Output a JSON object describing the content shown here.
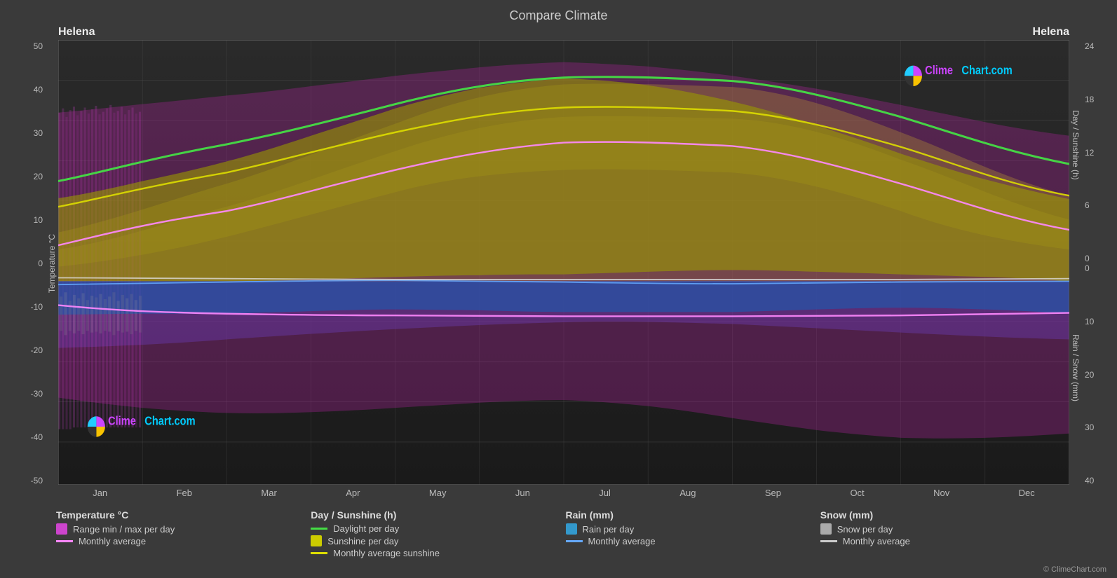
{
  "title": "Compare Climate",
  "location_left": "Helena",
  "location_right": "Helena",
  "y_axis_left_label": "Temperature °C",
  "y_axis_right_top_label": "Day / Sunshine (h)",
  "y_axis_right_bottom_label": "Rain / Snow (mm)",
  "y_ticks_left": [
    "50",
    "40",
    "30",
    "20",
    "10",
    "0",
    "-10",
    "-20",
    "-30",
    "-40",
    "-50"
  ],
  "y_ticks_right_top": [
    "24",
    "18",
    "12",
    "6",
    "0"
  ],
  "y_ticks_right_bottom": [
    "0",
    "10",
    "20",
    "30",
    "40"
  ],
  "x_ticks": [
    "Jan",
    "Feb",
    "Mar",
    "Apr",
    "May",
    "Jun",
    "Jul",
    "Aug",
    "Sep",
    "Oct",
    "Nov",
    "Dec"
  ],
  "logo_text": "ClimeChart.com",
  "copyright": "© ClimeChart.com",
  "legend": {
    "col1_title": "Temperature °C",
    "col1_items": [
      {
        "type": "rect",
        "color": "#cc44cc",
        "label": "Range min / max per day"
      },
      {
        "type": "line",
        "color": "#ff88ff",
        "label": "Monthly average"
      }
    ],
    "col2_title": "Day / Sunshine (h)",
    "col2_items": [
      {
        "type": "line",
        "color": "#44dd44",
        "label": "Daylight per day"
      },
      {
        "type": "rect",
        "color": "#cccc00",
        "label": "Sunshine per day"
      },
      {
        "type": "line",
        "color": "#dddd00",
        "label": "Monthly average sunshine"
      }
    ],
    "col3_title": "Rain (mm)",
    "col3_items": [
      {
        "type": "rect",
        "color": "#3399cc",
        "label": "Rain per day"
      },
      {
        "type": "line",
        "color": "#66aaff",
        "label": "Monthly average"
      }
    ],
    "col4_title": "Snow (mm)",
    "col4_items": [
      {
        "type": "rect",
        "color": "#aaaaaa",
        "label": "Snow per day"
      },
      {
        "type": "line",
        "color": "#cccccc",
        "label": "Monthly average"
      }
    ]
  }
}
